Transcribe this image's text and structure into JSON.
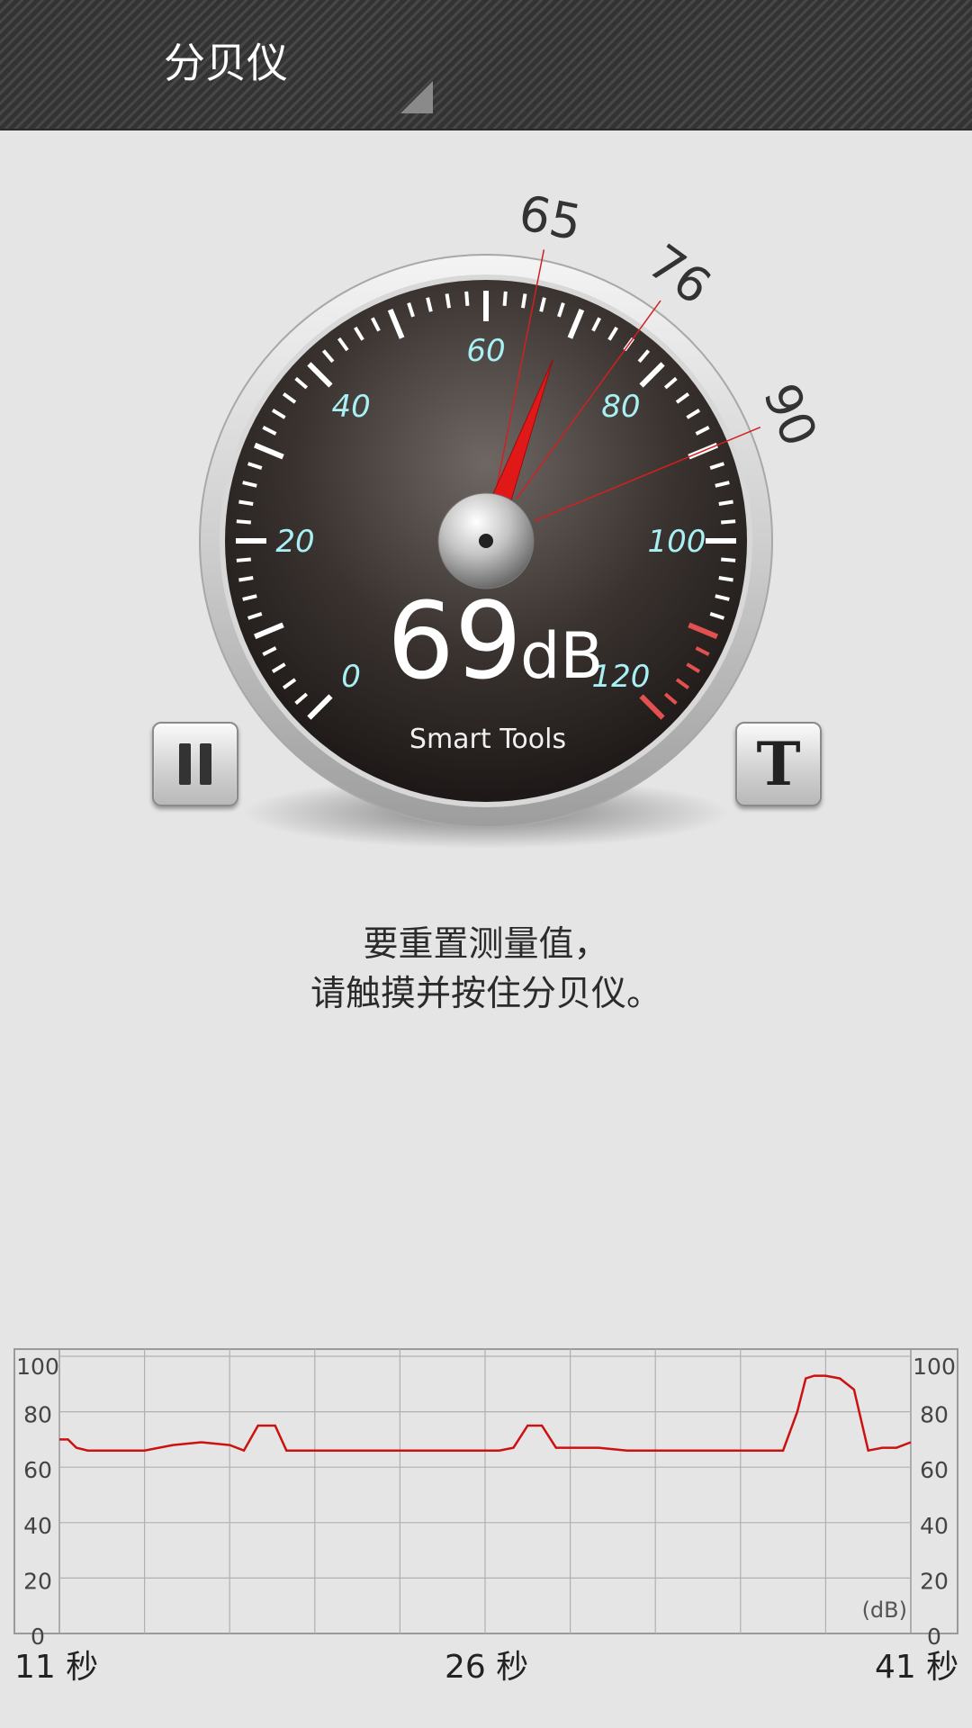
{
  "app": {
    "title": "分贝仪"
  },
  "gauge": {
    "reading_value": "69",
    "reading_unit": "dB",
    "brand": "Smart Tools",
    "needle_value": 69,
    "scale_min": 0,
    "scale_max": 120,
    "scale_labels": [
      "0",
      "20",
      "40",
      "60",
      "80",
      "100",
      "120"
    ],
    "markers": [
      {
        "value": 65,
        "label": "65"
      },
      {
        "value": 76,
        "label": "76"
      },
      {
        "value": 90,
        "label": "90"
      }
    ],
    "colors": {
      "scale_text": "#a8f0f4",
      "needle": "#e01818",
      "marker_line": "#d22020",
      "danger_ticks": "#e25050"
    }
  },
  "buttons": {
    "pause_icon": "pause-icon",
    "text_icon": "text-t-icon"
  },
  "hint": {
    "line1": "要重置测量值，",
    "line2": "请触摸并按住分贝仪。"
  },
  "chart_data": {
    "type": "line",
    "ylabel": "(dB)",
    "ylim": [
      0,
      100
    ],
    "y_ticks": [
      "0",
      "20",
      "40",
      "60",
      "80",
      "100"
    ],
    "x_labels": [
      "11 秒",
      "26 秒",
      "41 秒"
    ],
    "xlim": [
      11,
      41
    ],
    "grid": true,
    "series": [
      {
        "color": "#cc1111",
        "x": [
          11,
          11.3,
          11.6,
          12,
          13,
          14,
          15,
          16,
          17,
          17.5,
          18,
          18.6,
          19,
          19.4,
          19.7,
          20,
          20.5,
          21,
          22,
          23,
          24,
          25,
          26,
          26.5,
          27,
          27.5,
          28,
          28.5,
          29,
          30,
          31,
          32,
          33,
          34,
          35,
          36,
          36.5,
          37,
          37.3,
          37.6,
          38,
          38.5,
          39,
          39.5,
          40,
          40.5,
          41
        ],
        "y": [
          70,
          70,
          67,
          66,
          66,
          66,
          68,
          69,
          68,
          66,
          75,
          75,
          66,
          66,
          66,
          66,
          66,
          66,
          66,
          66,
          66,
          66,
          66,
          66,
          67,
          75,
          75,
          67,
          67,
          67,
          66,
          66,
          66,
          66,
          66,
          66,
          66,
          80,
          92,
          93,
          93,
          92,
          88,
          66,
          67,
          67,
          69
        ]
      }
    ]
  }
}
